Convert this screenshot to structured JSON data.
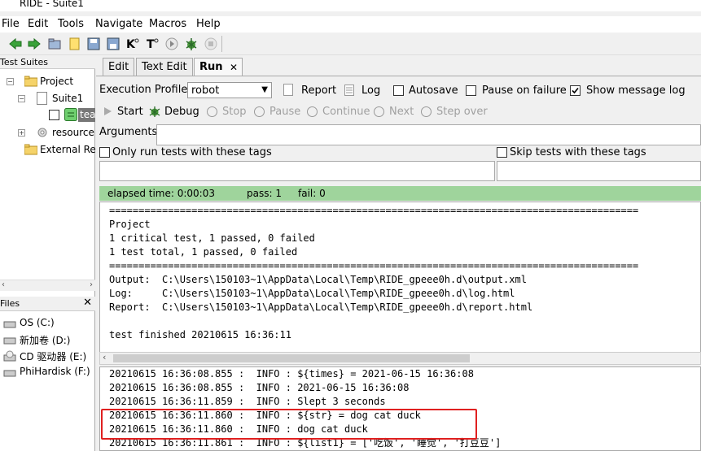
{
  "window": {
    "title": "RIDE - Suite1"
  },
  "menu": [
    "File",
    "Edit",
    "Tools",
    "Navigate",
    "Macros",
    "Help"
  ],
  "left": {
    "test_suites_header": "Test Suites",
    "tree": {
      "project": "Project",
      "suite": "Suite1",
      "test": "tea",
      "resource": "resource",
      "external": "External Re"
    },
    "files_header": "Files",
    "files": [
      "OS (C:)",
      "新加卷 (D:)",
      "CD 驱动器 (E:)",
      "PhiHardisk  (F:)"
    ]
  },
  "tabs": [
    "Edit",
    "Text Edit",
    "Run"
  ],
  "run": {
    "execution_profile_label": "Execution Profile:",
    "profile_value": "robot",
    "report_label": "Report",
    "log_label": "Log",
    "autosave_label": "Autosave",
    "pause_on_failure_label": "Pause on failure",
    "show_message_log_label": "Show message log",
    "start_label": "Start",
    "debug_label": "Debug",
    "stop_label": "Stop",
    "pause_label": "Pause",
    "continue_label": "Continue",
    "next_label": "Next",
    "step_over_label": "Step over",
    "arguments_label": "Arguments:",
    "only_run_label": "Only run tests with these tags",
    "skip_label": "Skip tests with these tags",
    "elapsed": "elapsed time: 0:00:03",
    "pass": "pass: 1",
    "fail": "fail: 0"
  },
  "output_lines": [
    "==========================================================================================",
    "Project",
    "1 critical test, 1 passed, 0 failed",
    "1 test total, 1 passed, 0 failed",
    "==========================================================================================",
    "Output:  C:\\Users\\150103~1\\AppData\\Local\\Temp\\RIDE_gpeee0h.d\\output.xml",
    "Log:     C:\\Users\\150103~1\\AppData\\Local\\Temp\\RIDE_gpeee0h.d\\log.html",
    "Report:  C:\\Users\\150103~1\\AppData\\Local\\Temp\\RIDE_gpeee0h.d\\report.html",
    "",
    "test finished 20210615 16:36:11"
  ],
  "log_lines": [
    "20210615 16:36:08.855 :  INFO : ${times} = 2021-06-15 16:36:08",
    "20210615 16:36:08.855 :  INFO : 2021-06-15 16:36:08",
    "20210615 16:36:11.859 :  INFO : Slept 3 seconds",
    "20210615 16:36:11.860 :  INFO : ${str} = dog cat duck",
    "20210615 16:36:11.860 :  INFO : dog cat duck",
    "20210615 16:36:11.861 :  INFO : ${list1} = ['吃饭', '睡觉', '打豆豆']"
  ],
  "colors": {
    "status_green": "#9fd49c",
    "highlight_red": "#e02020"
  }
}
